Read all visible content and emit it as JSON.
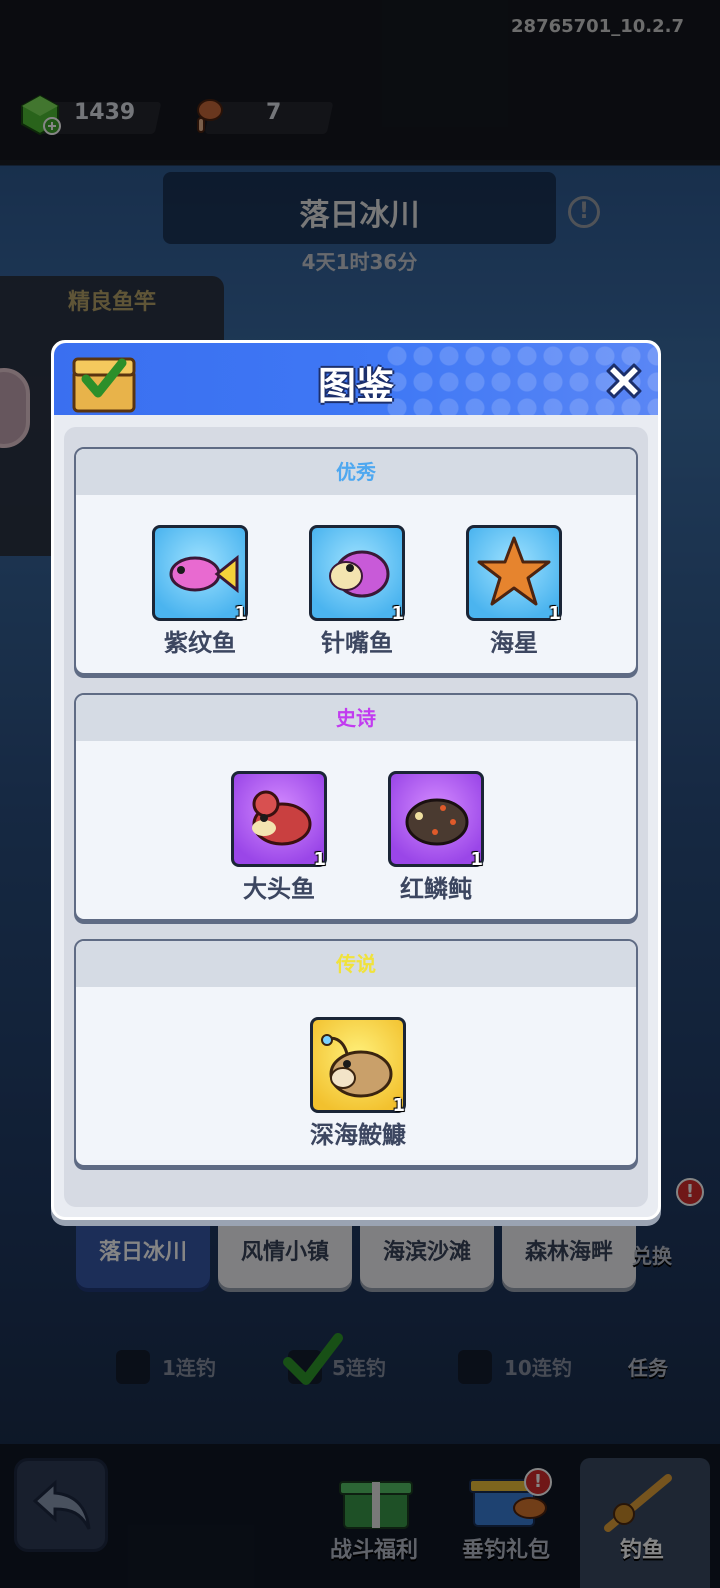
{
  "version": "28765701_10.2.7",
  "resources": {
    "gems": "1439",
    "bait": "7"
  },
  "stage": {
    "title": "落日冰川",
    "timer": "4天1时36分"
  },
  "rod_panel": {
    "title": "精良鱼竿"
  },
  "modal": {
    "title": "图鉴",
    "sections": [
      {
        "title": "优秀",
        "color": "#4fa8f0",
        "items": [
          {
            "name": "紫纹鱼",
            "count": "1"
          },
          {
            "name": "针嘴鱼",
            "count": "1"
          },
          {
            "name": "海星",
            "count": "1"
          }
        ]
      },
      {
        "title": "史诗",
        "color": "#c23cf0",
        "items": [
          {
            "name": "大头鱼",
            "count": "1"
          },
          {
            "name": "红鳞鲀",
            "count": "1"
          }
        ]
      },
      {
        "title": "传说",
        "color": "#f0e23c",
        "items": [
          {
            "name": "深海鮟鱇",
            "count": "1"
          }
        ]
      }
    ]
  },
  "tabs": [
    "落日冰川",
    "风情小镇",
    "海滨沙滩",
    "森林海畔"
  ],
  "side_right": {
    "exchange": "兑换",
    "task": "任务"
  },
  "multi_cast": {
    "opt1": "1连钓",
    "opt2": "5连钓",
    "opt3": "10连钓"
  },
  "bottom_nav": {
    "battle_welfare": "战斗福利",
    "fishing_pack": "垂钓礼包",
    "fishing": "钓鱼"
  },
  "colors": {
    "accent_blue": "#3f78f5",
    "tab_active": "#3758a9"
  }
}
